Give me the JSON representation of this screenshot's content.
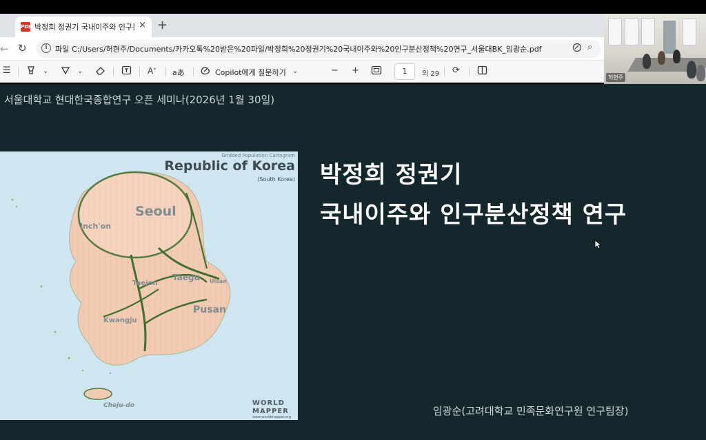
{
  "browser": {
    "tab": {
      "pdf_icon_label": "PDF",
      "title": "박정희 정권기 국내이주와 인구분산",
      "close_icon": "×"
    },
    "new_tab_icon": "+",
    "address": {
      "label": "파일",
      "url": "C:/Users/허현주/Documents/카카오톡%20받은%20파일/박정희%20정권기%20국내이주와%20인구분산정책%20연구_서울대BK_임광순.pdf"
    }
  },
  "pdf_toolbar": {
    "copilot_label": "Copilot에게 질문하기",
    "page_current": "1",
    "page_total": "의 29"
  },
  "webcam": {
    "name": "허현주"
  },
  "slide": {
    "subtitle": "서울대학교 현대한국종합연구 오픈 세미나(2026년 1월 30일)",
    "title_line1": "박정희 정권기",
    "title_line2": "국내이주와 인구분산정책 연구",
    "author": "임광순(고려대학교 민족문화연구원 연구팀장)",
    "map": {
      "caption": "Gridded Population Cartogram",
      "title": "Republic of Korea",
      "subtitle": "(South Korea)",
      "labels": {
        "seoul": "Seoul",
        "inchon": "Inch'on",
        "taegu": "Taegu",
        "taejon": "Taejon",
        "ulsan": "Ulsan",
        "pusan": "Pusan",
        "kwangju": "Kwangju",
        "cheju": "Cheju-do"
      },
      "watermark_line1": "WORLD",
      "watermark_line2": "MAPPER",
      "watermark_url": "www.worldmapper.org"
    }
  }
}
